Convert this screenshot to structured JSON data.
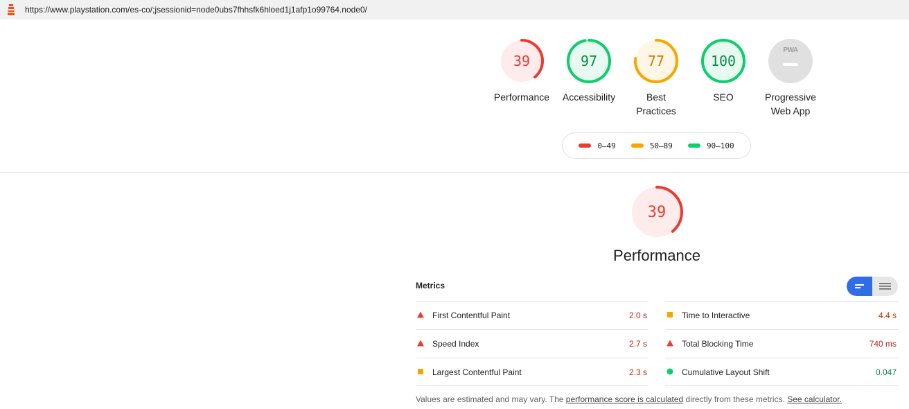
{
  "browser": {
    "url": "https://www.playstation.com/es-co/;jsessionid=node0ubs7fhhsfk6hloed1j1afp1o99764.node0/",
    "logo_icon": "lighthouse-icon"
  },
  "colors": {
    "fail": "#eb3b30",
    "average": "#fba400",
    "pass": "#0cce6b",
    "fail_bg": "#fdeceb",
    "average_bg": "#fff6e6",
    "pass_bg": "#e7f9f0",
    "neutral_bg": "#e0e0e0",
    "accent": "#2f6de6"
  },
  "gauges": [
    {
      "score": 39,
      "label": "Performance",
      "label2": "",
      "rating": "fail"
    },
    {
      "score": 97,
      "label": "Accessibility",
      "label2": "",
      "rating": "pass"
    },
    {
      "score": 77,
      "label": "Best",
      "label2": "Practices",
      "rating": "average"
    },
    {
      "score": 100,
      "label": "SEO",
      "label2": "",
      "rating": "pass"
    },
    {
      "score": null,
      "label": "Progressive",
      "label2": "Web App",
      "rating": "pwa",
      "badge": "PWA"
    }
  ],
  "legend": [
    {
      "range": "0–49",
      "rating": "fail"
    },
    {
      "range": "50–89",
      "rating": "average"
    },
    {
      "range": "90–100",
      "rating": "pass"
    }
  ],
  "performance": {
    "score": 39,
    "title": "Performance",
    "metrics_title": "Metrics",
    "view_toggle_icons": [
      "metric-view-list-icon",
      "metric-view-text-icon"
    ]
  },
  "metrics_left": [
    {
      "name": "First Contentful Paint",
      "value": "2.0 s",
      "rating": "fail"
    },
    {
      "name": "Speed Index",
      "value": "2.7 s",
      "rating": "fail"
    },
    {
      "name": "Largest Contentful Paint",
      "value": "2.3 s",
      "rating": "average"
    }
  ],
  "metrics_right": [
    {
      "name": "Time to Interactive",
      "value": "4.4 s",
      "rating": "average"
    },
    {
      "name": "Total Blocking Time",
      "value": "740 ms",
      "rating": "fail"
    },
    {
      "name": "Cumulative Layout Shift",
      "value": "0.047",
      "rating": "pass"
    }
  ],
  "note": {
    "part1": "Values are estimated and may vary. The ",
    "link1": "performance score is calculated",
    "part2": " directly from these metrics. ",
    "link2": "See calculator."
  }
}
